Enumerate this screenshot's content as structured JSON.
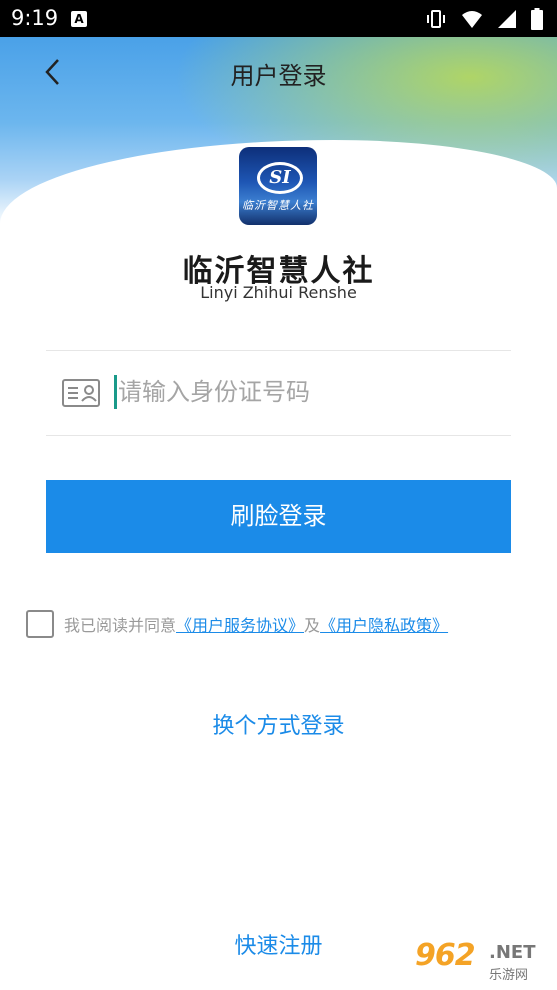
{
  "status_bar": {
    "time": "9:19",
    "a_badge": "A",
    "icons": [
      "vibrate-icon",
      "wifi-icon",
      "signal-icon",
      "battery-icon"
    ]
  },
  "header": {
    "title": "用户登录"
  },
  "brand": {
    "logo_mark": "SI",
    "logo_text": "临沂智慧人社",
    "name_cn": "临沂智慧人社",
    "name_en": "Linyi Zhihui Renshe"
  },
  "form": {
    "id_placeholder": "请输入身份证号码",
    "id_value": "",
    "face_login_label": "刷脸登录"
  },
  "agreement": {
    "prefix": "我已阅读并同意",
    "service_link": "《用户服务协议》",
    "joiner": "及",
    "privacy_link": "《用户隐私政策》",
    "checked": false
  },
  "actions": {
    "switch_login": "换个方式登录",
    "quick_register": "快速注册"
  },
  "watermark": {
    "main": "962",
    "net": ".NET",
    "sub": "乐游网"
  },
  "colors": {
    "accent": "#1b8be8",
    "caret": "#1a9a8a"
  }
}
